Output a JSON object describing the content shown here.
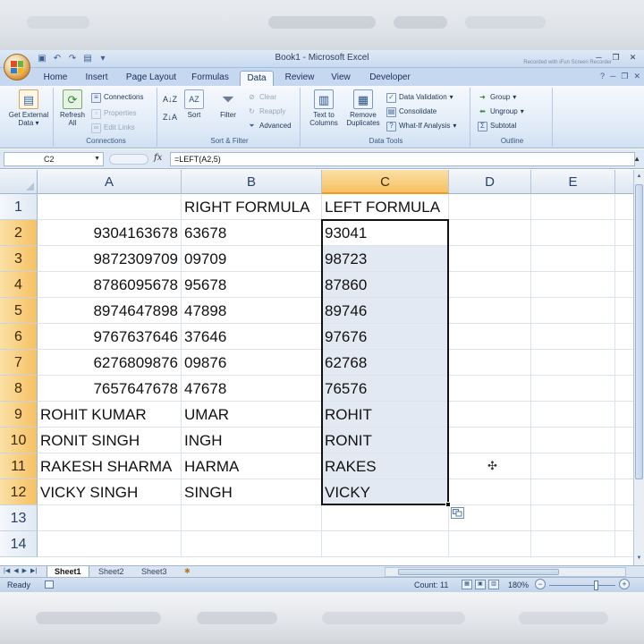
{
  "window": {
    "title": "Book1 - Microsoft Excel",
    "watermark": "Recorded with iFun Screen Recorder"
  },
  "ribbon": {
    "tabs": [
      "Home",
      "Insert",
      "Page Layout",
      "Formulas",
      "Data",
      "Review",
      "View",
      "Developer"
    ],
    "active_tab": "Data",
    "groups": {
      "get_external_label": "Get External Data",
      "refresh_label": "Refresh All",
      "connections_label": "Connections",
      "connections_btn": "Connections",
      "properties_btn": "Properties",
      "edit_links_btn": "Edit Links",
      "sort_filter_label": "Sort & Filter",
      "sort_btn": "Sort",
      "filter_btn": "Filter",
      "clear_btn": "Clear",
      "reapply_btn": "Reapply",
      "advanced_btn": "Advanced",
      "data_tools_label": "Data Tools",
      "text_to_columns_btn": "Text to Columns",
      "remove_duplicates_btn": "Remove Duplicates",
      "data_validation_btn": "Data Validation",
      "consolidate_btn": "Consolidate",
      "what_if_btn": "What-If Analysis",
      "outline_label": "Outline",
      "group_btn": "Group",
      "ungroup_btn": "Ungroup",
      "subtotal_btn": "Subtotal"
    }
  },
  "formula_bar": {
    "name_box": "C2",
    "fx": "fx",
    "formula": "=LEFT(A2,5)"
  },
  "grid": {
    "columns": [
      "A",
      "B",
      "C",
      "D",
      "E"
    ],
    "rows": [
      {
        "n": "1",
        "a": "",
        "b": "RIGHT FORMULA",
        "c": "LEFT FORMULA"
      },
      {
        "n": "2",
        "a": "9304163678",
        "b": "63678",
        "c": "93041"
      },
      {
        "n": "3",
        "a": "9872309709",
        "b": "09709",
        "c": "98723"
      },
      {
        "n": "4",
        "a": "8786095678",
        "b": "95678",
        "c": "87860"
      },
      {
        "n": "5",
        "a": "8974647898",
        "b": "47898",
        "c": "89746"
      },
      {
        "n": "6",
        "a": "9767637646",
        "b": "37646",
        "c": "97676"
      },
      {
        "n": "7",
        "a": "6276809876",
        "b": "09876",
        "c": "62768"
      },
      {
        "n": "8",
        "a": "7657647678",
        "b": "47678",
        "c": "76576"
      },
      {
        "n": "9",
        "a": "ROHIT KUMAR",
        "b": "UMAR",
        "c": "ROHIT"
      },
      {
        "n": "10",
        "a": "RONIT SINGH",
        "b": "INGH",
        "c": "RONIT"
      },
      {
        "n": "11",
        "a": "RAKESH SHARMA",
        "b": "HARMA",
        "c": "RAKES"
      },
      {
        "n": "12",
        "a": "VICKY SINGH",
        "b": "SINGH",
        "c": "VICKY"
      },
      {
        "n": "13",
        "a": "",
        "b": "",
        "c": ""
      },
      {
        "n": "14",
        "a": "",
        "b": "",
        "c": ""
      }
    ],
    "selected_column": "C",
    "selected_rows": [
      "2",
      "3",
      "4",
      "5",
      "6",
      "7",
      "8",
      "9",
      "10",
      "11",
      "12"
    ]
  },
  "sheets": [
    "Sheet1",
    "Sheet2",
    "Sheet3"
  ],
  "active_sheet": "Sheet1",
  "status": {
    "ready": "Ready",
    "count": "Count: 11",
    "zoom": "180%",
    "zoom_level": 0.72
  },
  "colors": {
    "selection_header": "#f6c163",
    "ribbon": "#dfeaf7",
    "grid_line": "#dde3ea"
  }
}
